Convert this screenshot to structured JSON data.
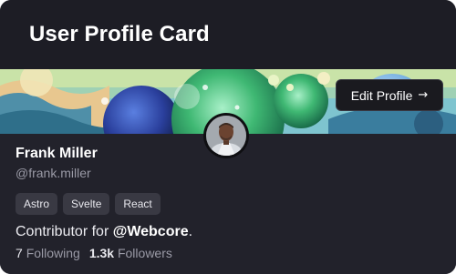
{
  "card": {
    "title": "User Profile Card",
    "edit_button": "Edit Profile",
    "edit_arrow": "→"
  },
  "profile": {
    "name": "Frank Miller",
    "handle": "@frank.miller",
    "tags": [
      "Astro",
      "Svelte",
      "React"
    ],
    "contributor_prefix": "Contributor for ",
    "organization": "@Webcore",
    "contributor_suffix": ".",
    "following_count": "7",
    "following_label": "Following",
    "followers_count": "1.3k",
    "followers_label": "Followers"
  },
  "colors": {
    "background": "#1f1f27",
    "banner_sky": "#6fb6c6",
    "accent_green": "#3fae6a"
  },
  "icons": {
    "edit_arrow": "arrow-right-icon"
  }
}
